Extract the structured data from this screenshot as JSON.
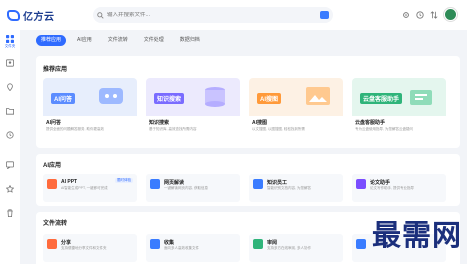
{
  "app": {
    "logo_text": "亿方云"
  },
  "search": {
    "placeholder": "输入并搜索文件..."
  },
  "sidebar": {
    "items": [
      {
        "label": "文件夹",
        "icon": "grid-icon"
      },
      {
        "label": "",
        "icon": "user-card-icon"
      },
      {
        "label": "",
        "icon": "location-icon"
      },
      {
        "label": "",
        "icon": "folder-icon"
      },
      {
        "label": "",
        "icon": "clock-icon"
      },
      {
        "label": "",
        "icon": "message-icon"
      },
      {
        "label": "",
        "icon": "star-icon"
      },
      {
        "label": "",
        "icon": "trash-icon"
      }
    ]
  },
  "tabs": [
    "推荐应用",
    "AI应用",
    "文件流转",
    "文件处理",
    "数据归档"
  ],
  "recommended": {
    "title": "推荐应用",
    "cards": [
      {
        "tag": "AI问答",
        "name": "AI问答",
        "desc": "提供全面的问题解答服务, 助你更高效",
        "color": "#5b8cff",
        "bg": "#e7eefc"
      },
      {
        "tag": "知识搜索",
        "name": "知识搜索",
        "desc": "基于知识库, 高效查找所需内容",
        "color": "#7a6cff",
        "bg": "#eceafd"
      },
      {
        "tag": "AI搜图",
        "name": "AI搜图",
        "desc": "以文搜图, 以图搜图, 轻松找到所需",
        "color": "#ff9a3a",
        "bg": "#fdf1e4"
      },
      {
        "tag": "云盘客服助手",
        "name": "云盘客服助手",
        "desc": "专为云盘使用指导, 为您解答云盘疑问",
        "color": "#2fb47a",
        "bg": "#e4f6ee"
      }
    ]
  },
  "ai_apps": {
    "title": "AI应用",
    "cards": [
      {
        "name": "AI PPT",
        "desc": "AI智能生成PPT, 一键即可完成",
        "badge": "限时体验",
        "color": "#ff6b3d"
      },
      {
        "name": "网页解读",
        "desc": "一键解读网页内容, 获取信息",
        "badge": "",
        "color": "#3a7cff"
      },
      {
        "name": "知识员工",
        "desc": "智能识别文档内容, 为您解答",
        "badge": "",
        "color": "#3a7cff"
      },
      {
        "name": "论文助手",
        "desc": "论文写作助手, 提供专业指导",
        "badge": "",
        "color": "#7a4dff"
      }
    ]
  },
  "file_flow": {
    "title": "文件流转",
    "cards": [
      {
        "name": "分享",
        "desc": "支持便捷地分享文件和文件夹",
        "color": "#ff6b3d"
      },
      {
        "name": "收集",
        "desc": "面向多人高效收集文件",
        "color": "#3a7cff"
      },
      {
        "name": "审阅",
        "desc": "支持多方在线审阅, 多人协作",
        "color": "#2fb47a"
      },
      {
        "name": "",
        "desc": "",
        "color": "#3a7cff"
      }
    ]
  },
  "watermark": {
    "text": "最需网"
  },
  "colors": {
    "accent": "#2f6bff",
    "brand": "#1d3d8f"
  }
}
